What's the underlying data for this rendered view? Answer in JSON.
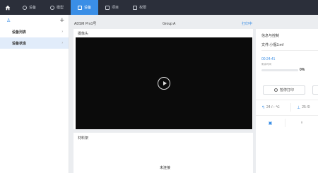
{
  "nav": {
    "items": [
      {
        "label": "设备",
        "active": false
      },
      {
        "label": "模型",
        "active": false
      },
      {
        "label": "设备",
        "active": true
      },
      {
        "label": "项目",
        "active": false
      },
      {
        "label": "权限",
        "active": false
      }
    ]
  },
  "sidebar": {
    "items": [
      {
        "label": "设备列表",
        "active": false
      },
      {
        "label": "设备状态",
        "active": true
      }
    ]
  },
  "device": {
    "model": "ADSM Pro1号",
    "group": "Group A",
    "status": "打印中"
  },
  "camera": {
    "title": "摄像头"
  },
  "material": {
    "title": "材料架",
    "empty": "未连接"
  },
  "info": {
    "title": "信息与控制",
    "file": "文件:小瓶3.mf",
    "time": "00:24:41",
    "time_caption": "剩余时间",
    "progress_label": "0%",
    "progress": 0,
    "pause_label": "暂停打印",
    "nozzle_temp": "24 /-- ℃",
    "bed_temp": "25 /0"
  },
  "colors": {
    "accent": "#3a8ee6",
    "nav_bg": "#2b2f3a"
  }
}
